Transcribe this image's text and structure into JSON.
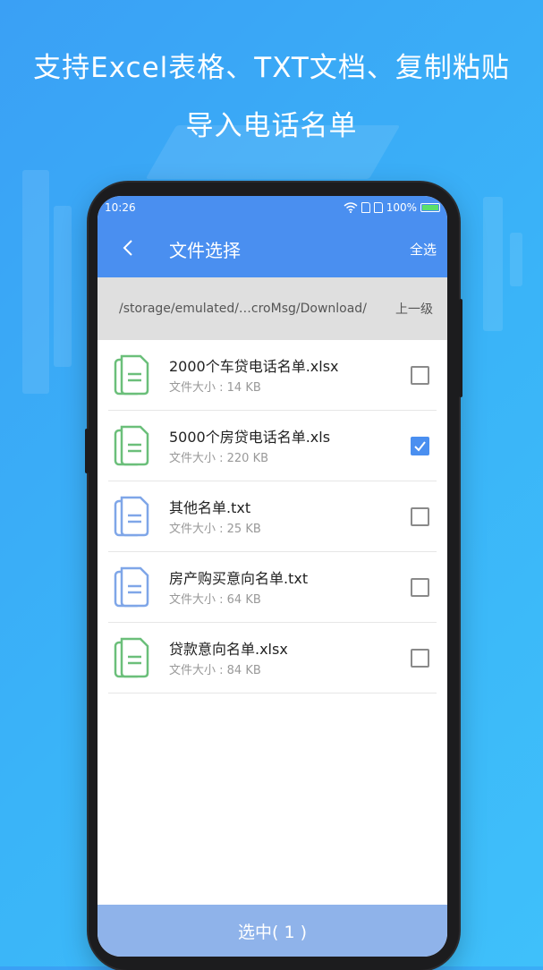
{
  "promo": {
    "line1": "支持Excel表格、TXT文档、复制粘贴",
    "line2": "导入电话名单"
  },
  "status_bar": {
    "time": "10:26",
    "battery": "100%"
  },
  "nav": {
    "title": "文件选择",
    "select_all": "全选",
    "back_icon": "chevron-left-icon"
  },
  "path": {
    "current": "/storage/emulated/…croMsg/Download/",
    "up": "上一级"
  },
  "files": [
    {
      "name": "2000个车贷电话名单.xlsx",
      "size": "文件大小 : 14 KB",
      "type": "xlsx",
      "icon_color": "#6bbf7a",
      "checked": false
    },
    {
      "name": "5000个房贷电话名单.xls",
      "size": "文件大小 : 220 KB",
      "type": "xls",
      "icon_color": "#6bbf7a",
      "checked": true
    },
    {
      "name": "其他名单.txt",
      "size": "文件大小 : 25 KB",
      "type": "txt",
      "icon_color": "#7fa6e8",
      "checked": false
    },
    {
      "name": "房产购买意向名单.txt",
      "size": "文件大小 : 64 KB",
      "type": "txt",
      "icon_color": "#7fa6e8",
      "checked": false
    },
    {
      "name": "贷款意向名单.xlsx",
      "size": "文件大小 : 84 KB",
      "type": "xlsx",
      "icon_color": "#6bbf7a",
      "checked": false
    }
  ],
  "bottom": {
    "selected_label": "选中( 1 )"
  }
}
